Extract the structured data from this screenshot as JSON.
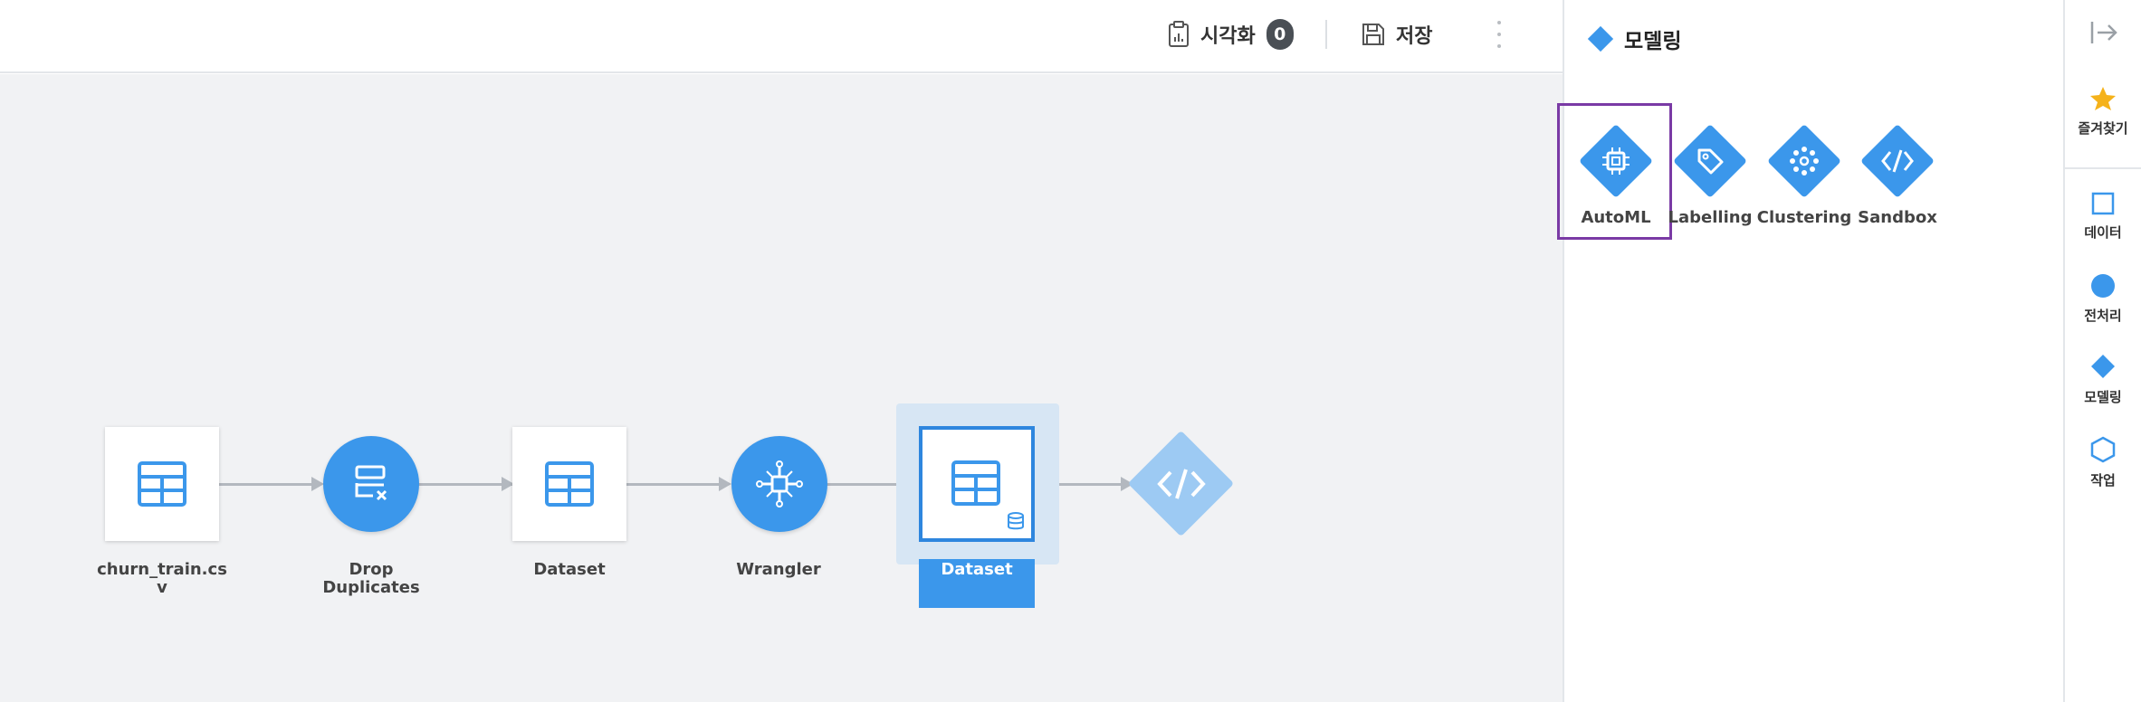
{
  "toolbar": {
    "visualize_label": "시각화",
    "visualize_count": "0",
    "save_label": "저장"
  },
  "pipeline": {
    "nodes": [
      {
        "id": "churn",
        "label": "churn_train.cs\nv",
        "shape": "square",
        "icon": "table-icon"
      },
      {
        "id": "drop",
        "label": "Drop\nDuplicates",
        "shape": "circle",
        "icon": "drop-duplicates-icon"
      },
      {
        "id": "dataset1",
        "label": "Dataset",
        "shape": "square",
        "icon": "table-icon"
      },
      {
        "id": "wrangler",
        "label": "Wrangler",
        "shape": "circle",
        "icon": "wrangler-icon"
      },
      {
        "id": "dataset2",
        "label": "Dataset",
        "shape": "square",
        "icon": "table-database-icon",
        "selected": true
      },
      {
        "id": "code",
        "label": "",
        "shape": "diamond",
        "icon": "code-icon"
      }
    ]
  },
  "panel": {
    "title": "모델링",
    "tools": [
      {
        "label": "AutoML",
        "icon": "chip-icon",
        "highlighted": true
      },
      {
        "label": "Labelling",
        "icon": "tag-icon"
      },
      {
        "label": "Clustering",
        "icon": "clustering-icon"
      },
      {
        "label": "Sandbox",
        "icon": "code-icon"
      }
    ]
  },
  "rail": {
    "items": [
      {
        "label": "즐겨찾기",
        "icon": "star-icon"
      },
      {
        "label": "데이터",
        "icon": "square-icon"
      },
      {
        "label": "전처리",
        "icon": "circle-icon"
      },
      {
        "label": "모델링",
        "icon": "diamond-icon"
      },
      {
        "label": "작업",
        "icon": "hexagon-icon"
      }
    ]
  },
  "colors": {
    "accent": "#3b97eb",
    "highlight_border": "#7a3aa5",
    "canvas_bg": "#f1f2f4"
  }
}
